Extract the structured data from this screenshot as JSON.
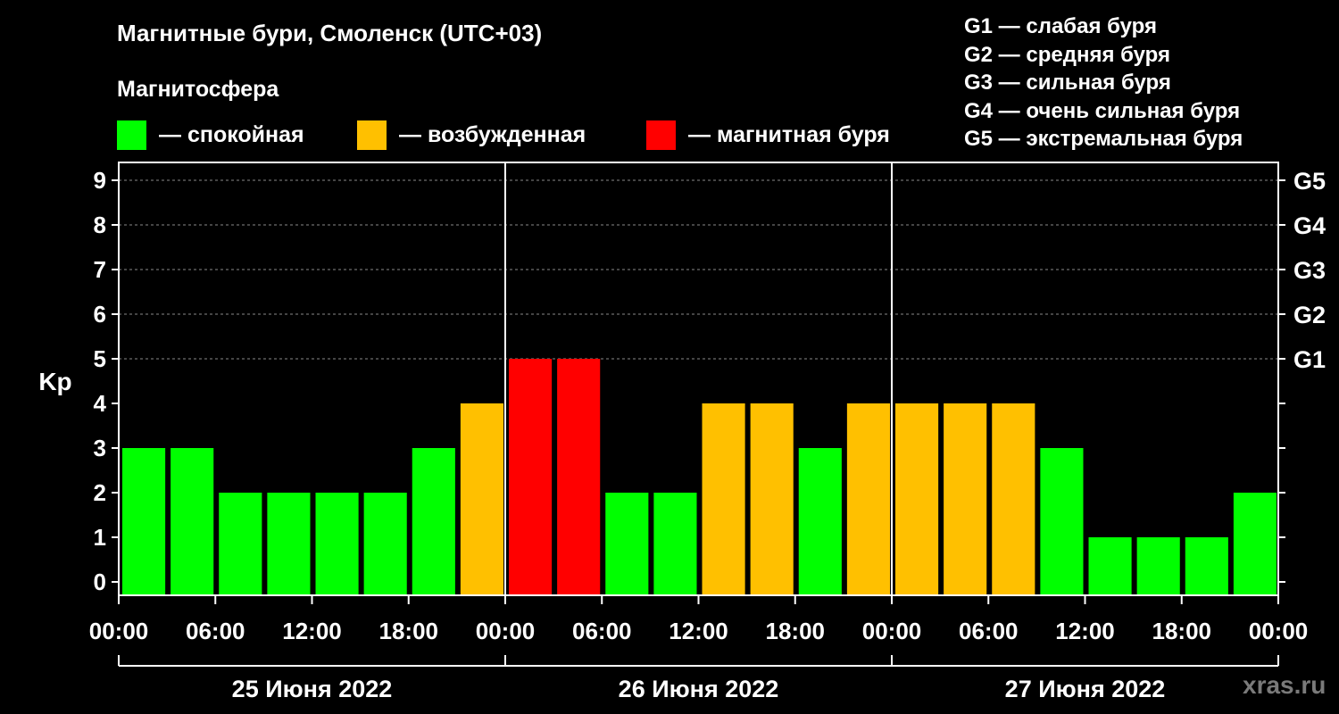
{
  "title": "Магнитные бури, Смоленск (UTC+03)",
  "legend": {
    "heading": "Магнитосфера",
    "items": [
      {
        "label": "— спокойная",
        "color": "#00ff00"
      },
      {
        "label": "— возбужденная",
        "color": "#ffc000"
      },
      {
        "label": "— магнитная буря",
        "color": "#ff0000"
      }
    ]
  },
  "g_scale": [
    "G1 — слабая буря",
    "G2 — средняя буря",
    "G3 — сильная буря",
    "G4 — очень сильная буря",
    "G5 — экстремальная буря"
  ],
  "watermark": "xras.ru",
  "chart_data": {
    "type": "bar",
    "ylabel": "Kp",
    "ylim": [
      0,
      9
    ],
    "y_ticks": [
      "0",
      "1",
      "2",
      "3",
      "4",
      "5",
      "6",
      "7",
      "8",
      "9"
    ],
    "right_ticks": [
      {
        "value": 5,
        "label": "G1"
      },
      {
        "value": 6,
        "label": "G2"
      },
      {
        "value": 7,
        "label": "G3"
      },
      {
        "value": 8,
        "label": "G4"
      },
      {
        "value": 9,
        "label": "G5"
      }
    ],
    "grid": "dashed horizontal lines at Kp 5–9",
    "x_tick_labels": [
      "00:00",
      "06:00",
      "12:00",
      "18:00",
      "00:00",
      "06:00",
      "12:00",
      "18:00",
      "00:00",
      "06:00",
      "12:00",
      "18:00",
      "00:00"
    ],
    "days": [
      "25 Июня 2022",
      "26 Июня 2022",
      "27 Июня 2022"
    ],
    "interval_hours": 3,
    "values": [
      3,
      3,
      2,
      2,
      2,
      2,
      3,
      4,
      5,
      5,
      2,
      2,
      4,
      4,
      3,
      4,
      4,
      4,
      4,
      3,
      1,
      1,
      1,
      2
    ],
    "colors": {
      "quiet": "#00ff00",
      "active": "#ffc000",
      "storm": "#ff0000"
    }
  }
}
